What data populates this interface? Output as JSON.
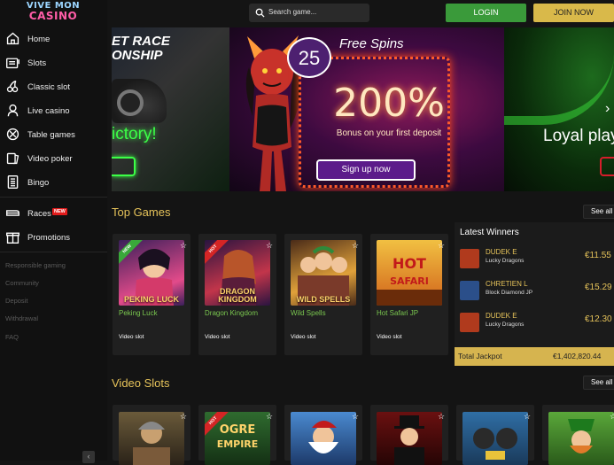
{
  "brand": {
    "line1": "VIVE MON",
    "line2": "CASINO"
  },
  "search": {
    "placeholder": "Search game..."
  },
  "auth": {
    "login": "LOGIN",
    "join": "JOIN NOW"
  },
  "nav": [
    {
      "label": "Home",
      "icon": "home-icon"
    },
    {
      "label": "Slots",
      "icon": "slot-machine-icon"
    },
    {
      "label": "Classic slot",
      "icon": "cherries-icon"
    },
    {
      "label": "Live casino",
      "icon": "dealer-icon"
    },
    {
      "label": "Table games",
      "icon": "roulette-icon"
    },
    {
      "label": "Video poker",
      "icon": "cards-icon"
    },
    {
      "label": "Bingo",
      "icon": "bingo-card-icon"
    },
    {
      "label": "Races",
      "icon": "races-icon",
      "badge": "NEW"
    },
    {
      "label": "Promotions",
      "icon": "gift-icon"
    }
  ],
  "footer_links": [
    "Responsible gaming",
    "Community",
    "Deposit",
    "Withdrawal",
    "FAQ"
  ],
  "banner": {
    "slide1": {
      "title": "ET RACE\nONSHIP",
      "tagline": "ictory!"
    },
    "slide2": {
      "badge_number": "25",
      "free_spins": "Free Spins",
      "percent": "200%",
      "subtitle": "Bonus on your first deposit",
      "cta": "Sign up now"
    },
    "slide3": {
      "tagline": "Loyal play"
    }
  },
  "top_games": {
    "title": "Top Games",
    "see_all": "See all",
    "cards": [
      {
        "art_text": "PEKING LUCK",
        "title": "Peking Luck",
        "type": "Video slot",
        "ribbon": "NEW",
        "ribbon_color": "#3aa83a",
        "bg": "#3b1f5a",
        "accent": "#e34b8a"
      },
      {
        "art_text": "DRAGON KINGDOM",
        "title": "Dragon Kingdom",
        "type": "Video slot",
        "ribbon": "HOT",
        "ribbon_color": "#d42525",
        "bg": "#2a1440",
        "accent": "#c2354a"
      },
      {
        "art_text": "WILD SPELLS",
        "title": "Wild Spells",
        "type": "Video slot",
        "ribbon": "",
        "ribbon_color": "",
        "bg": "#4a2b18",
        "accent": "#e0a13a"
      },
      {
        "art_text": "HOT SAFARI",
        "title": "Hot Safari JP",
        "type": "Video slot",
        "ribbon": "",
        "ribbon_color": "",
        "bg": "#d1621a",
        "accent": "#f1c042"
      }
    ]
  },
  "latest_winners": {
    "title": "Latest Winners",
    "rows": [
      {
        "name": "DUDEK E",
        "game": "Lucky Dragons",
        "amount": "€11.55",
        "color": "#b03a1d"
      },
      {
        "name": "CHRETIEN L",
        "game": "Block Diamond JP",
        "amount": "€15.29",
        "color": "#2b4f8a"
      },
      {
        "name": "DUDEK E",
        "game": "Lucky Dragons",
        "amount": "€12.30",
        "color": "#b03a1d"
      }
    ],
    "jackpot_label": "Total Jackpot",
    "jackpot_value": "€1,402,820.44"
  },
  "video_slots": {
    "title": "Video Slots",
    "see_all": "See all",
    "cards": [
      {
        "art_text": "",
        "bg": "#6a5a3a",
        "ribbon": "",
        "ribbon_color": ""
      },
      {
        "art_text": "OGRE EMPIRE",
        "bg": "#2f6b2f",
        "ribbon": "HOT",
        "ribbon_color": "#d42525"
      },
      {
        "art_text": "",
        "bg": "#4a8ad0",
        "ribbon": "",
        "ribbon_color": ""
      },
      {
        "art_text": "",
        "bg": "#6a1010",
        "ribbon": "",
        "ribbon_color": ""
      },
      {
        "art_text": "",
        "bg": "#2f6ea5",
        "ribbon": "",
        "ribbon_color": ""
      },
      {
        "art_text": "",
        "bg": "#5aa83a",
        "ribbon": "",
        "ribbon_color": ""
      }
    ]
  },
  "colors": {
    "accent_gold": "#e6c35a",
    "login_green": "#3a9a3a",
    "join_gold": "#d9b94a",
    "link_green": "#7ac74f"
  }
}
